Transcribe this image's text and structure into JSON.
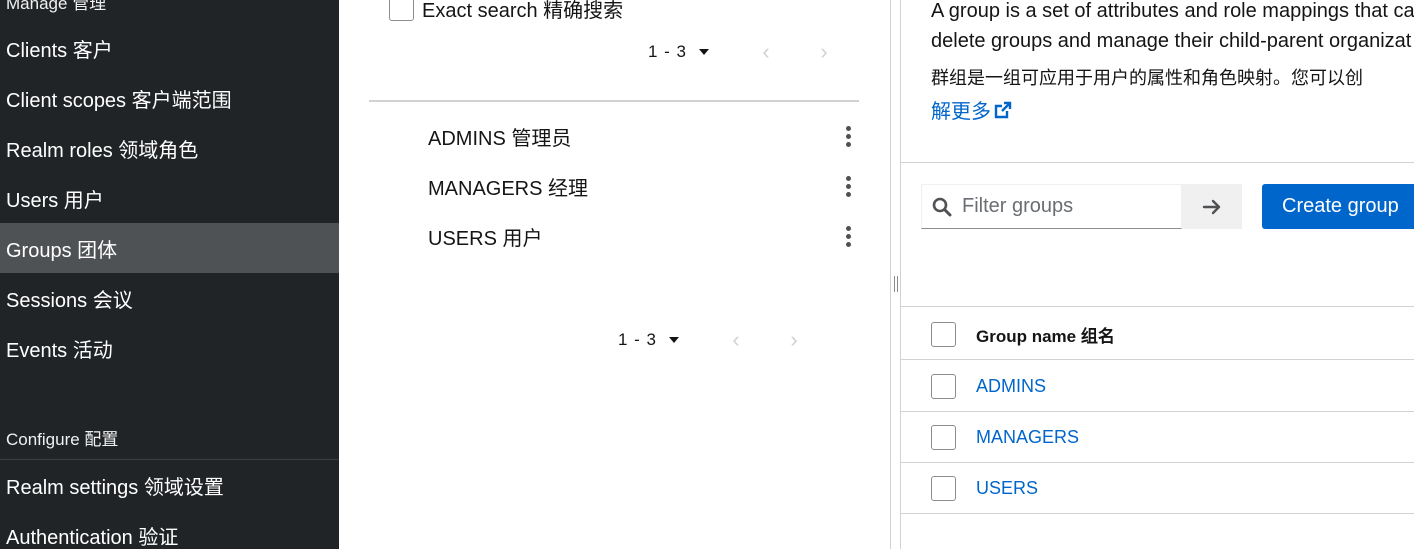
{
  "sidebar": {
    "manage_title": "Manage 管理",
    "items": [
      {
        "label": "Clients 客户"
      },
      {
        "label": "Client scopes 客户端范围"
      },
      {
        "label": "Realm roles 领域角色"
      },
      {
        "label": "Users 用户"
      },
      {
        "label": "Groups 团体"
      },
      {
        "label": "Sessions 会议"
      },
      {
        "label": "Events 活动"
      }
    ],
    "configure_title": "Configure 配置",
    "configure_items": [
      {
        "label": "Realm settings 领域设置"
      },
      {
        "label": "Authentication 验证"
      }
    ],
    "active_item": "Groups 团体"
  },
  "tree": {
    "exact_search_label": "Exact search 精确搜索",
    "exact_search_checked": false,
    "pagination_range": "1 - 3",
    "groups": [
      {
        "label": "ADMINS 管理员"
      },
      {
        "label": "MANAGERS 经理"
      },
      {
        "label": "USERS 用户"
      }
    ]
  },
  "right": {
    "description_line1": "A group is a set of attributes and role mappings that ca",
    "description_line2": "delete groups and manage their child-parent organizat",
    "description_zh": "群组是一组可应用于用户的属性和角色映射。您可以创",
    "learn_more": "解更多",
    "search_placeholder": "Filter groups",
    "create_button": "Create group",
    "table": {
      "header": "Group name 组名",
      "rows": [
        {
          "name": "ADMINS"
        },
        {
          "name": "MANAGERS"
        },
        {
          "name": "USERS"
        }
      ]
    }
  },
  "colors": {
    "sidebar_bg": "#212427",
    "active_bg": "#4f5255",
    "link": "#0066cc",
    "primary": "#0066cc"
  }
}
